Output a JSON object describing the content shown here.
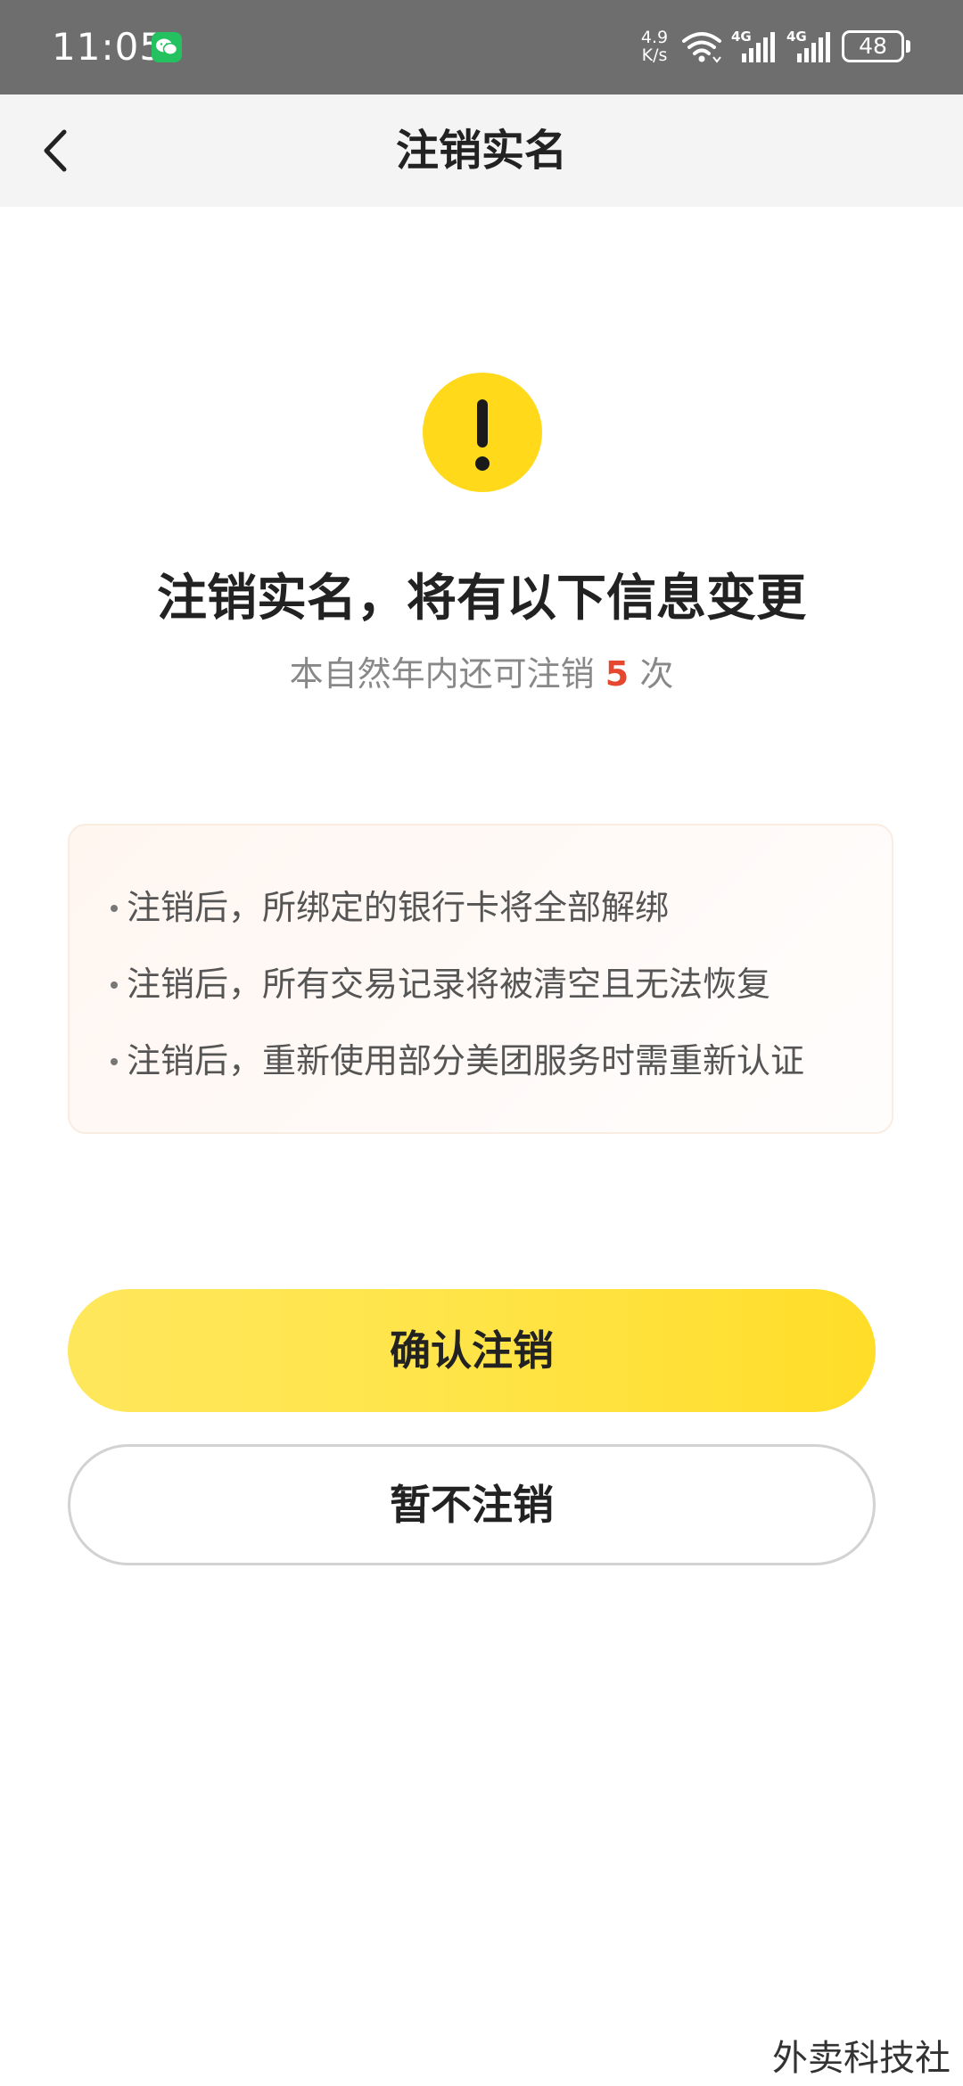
{
  "status_bar": {
    "time": "11:05",
    "net_speed_value": "4.9",
    "net_speed_unit": "K/s",
    "signal_1_label": "4G",
    "signal_2_label": "4G",
    "battery": "48"
  },
  "nav": {
    "title": "注销实名"
  },
  "content": {
    "headline": "注销实名，将有以下信息变更",
    "sub_prefix": "本自然年内还可注销",
    "sub_count": "5",
    "sub_suffix": "次",
    "info_items": [
      "注销后，所绑定的银行卡将全部解绑",
      "注销后，所有交易记录将被清空且无法恢复",
      "注销后，重新使用部分美团服务时需重新认证"
    ]
  },
  "buttons": {
    "confirm_label": "确认注销",
    "cancel_label": "暂不注销"
  },
  "footer": {
    "watermark": "外卖科技社"
  },
  "colors": {
    "accent_yellow": "#ffd91a",
    "count_red": "#e5472f",
    "status_bar_bg": "#6e6e6e"
  }
}
